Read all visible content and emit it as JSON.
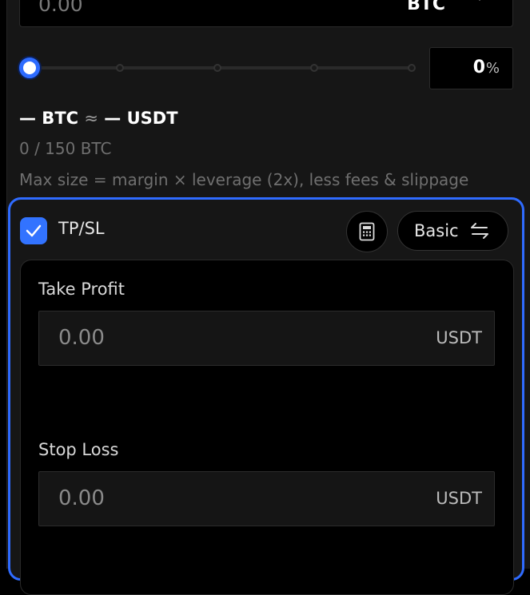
{
  "amount": {
    "value": "0.00",
    "currency": "BTC"
  },
  "slider": {
    "percent_value": "0",
    "percent_unit": "%"
  },
  "estimate": {
    "btc": "— BTC",
    "approx": "≈",
    "usdt": "— USDT"
  },
  "size": "0 / 150 BTC",
  "max_info": "Max size = margin × leverage (2x), less fees & slippage",
  "tpsl": {
    "label": "TP/SL",
    "checked": true,
    "mode_label": "Basic",
    "take_profit": {
      "label": "Take Profit",
      "value": "0.00",
      "unit": "USDT"
    },
    "stop_loss": {
      "label": "Stop Loss",
      "value": "0.00",
      "unit": "USDT"
    }
  },
  "colors": {
    "accent": "#2f6bff",
    "background": "#000000",
    "panel": "#161616"
  },
  "icons": {
    "dropdown": "chevron-down-icon",
    "check": "check-icon",
    "calculator": "calculator-icon",
    "switch": "swap-arrows-icon"
  }
}
